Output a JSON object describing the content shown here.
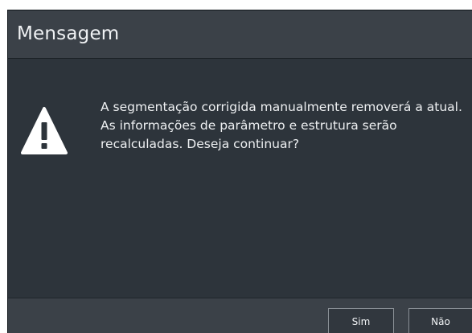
{
  "dialog": {
    "title": "Mensagem",
    "icon": "warning-icon",
    "message": "A segmentação corrigida manualmente removerá a atual. As informações de parâmetro e estrutura serão recalculadas. Deseja continuar?",
    "buttons": {
      "yes_label": "Sim",
      "no_label": "Não"
    }
  },
  "colors": {
    "titlebar": "#3b4148",
    "body": "#2d343b",
    "text": "#eef0f2",
    "button_border": "#8b9197"
  }
}
